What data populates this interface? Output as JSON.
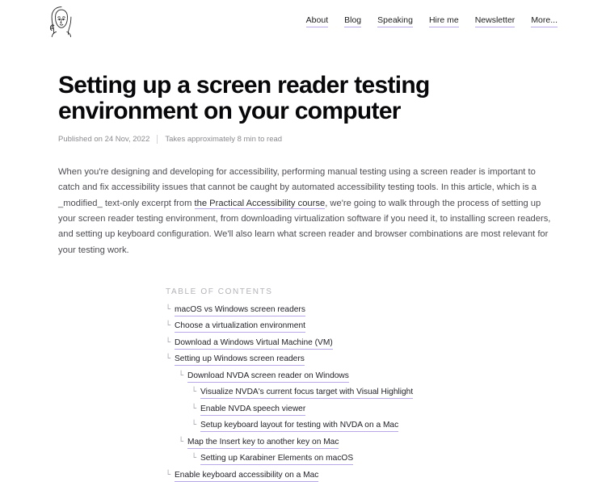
{
  "header": {
    "logo_icon": "author-portrait-avatar-icon",
    "nav": [
      {
        "label": "About"
      },
      {
        "label": "Blog"
      },
      {
        "label": "Speaking"
      },
      {
        "label": "Hire me"
      },
      {
        "label": "Newsletter"
      },
      {
        "label": "More..."
      }
    ]
  },
  "article": {
    "title": "Setting up a screen reader testing environment on your computer",
    "published": "Published on 24 Nov, 2022",
    "read_time": "Takes approximately 8 min to read",
    "intro_part1": "When you're designing and developing for accessibility, performing manual testing using a screen reader is important to catch and fix accessibility issues that cannot be caught by automated accessibility testing tools. In this article, which is a _modified_ text-only excerpt from ",
    "intro_link": "the Practical Accessibility course",
    "intro_part2": ", we're going to walk through the process of setting up your screen reader testing environment, from downloading virtualization software if you need it, to installing screen readers, and setting up keyboard configuration. We'll also learn what screen reader and browser combinations are most relevant for your testing work."
  },
  "toc": {
    "heading": "Table of contents",
    "marker": "└",
    "items": [
      {
        "label": "macOS vs Windows screen readers",
        "level": 0
      },
      {
        "label": "Choose a virtualization environment",
        "level": 0
      },
      {
        "label": "Download a Windows Virtual Machine (VM)",
        "level": 0
      },
      {
        "label": "Setting up Windows screen readers",
        "level": 0
      },
      {
        "label": "Download NVDA screen reader on Windows",
        "level": 1
      },
      {
        "label": "Visualize NVDA's current focus target with Visual Highlight",
        "level": 2
      },
      {
        "label": "Enable NVDA speech viewer",
        "level": 2
      },
      {
        "label": "Setup keyboard layout for testing with NVDA on a Mac",
        "level": 2
      },
      {
        "label": "Map the Insert key to another key on Mac",
        "level": 1
      },
      {
        "label": "Setting up Karabiner Elements on macOS",
        "level": 2
      },
      {
        "label": "Enable keyboard accessibility on a Mac",
        "level": 0
      }
    ]
  },
  "colors": {
    "link_underline": "#b9a8e8",
    "body_text": "#4c4c53",
    "heading_text": "#08080a",
    "muted_text": "#8b8b90",
    "background": "#ffffff"
  }
}
